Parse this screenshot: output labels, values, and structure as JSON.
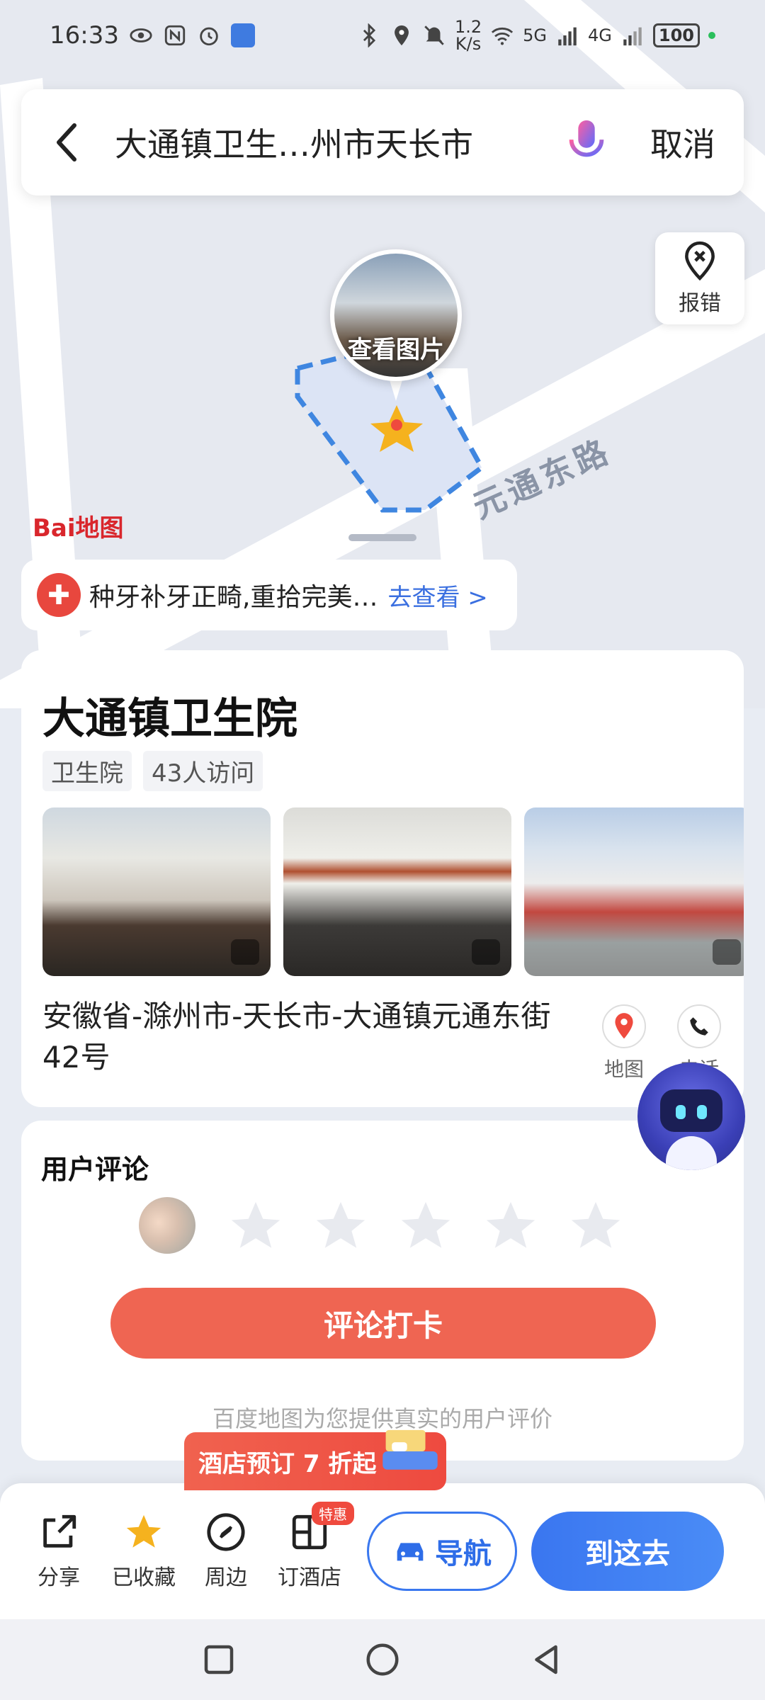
{
  "status": {
    "time": "16:33",
    "speed_top": "1.2",
    "speed_unit": "K/s",
    "battery": "100",
    "signal1": "5G",
    "signal2": "4G"
  },
  "search": {
    "query": "大通镇卫生…州市天长市",
    "cancel": "取消"
  },
  "map": {
    "report_label": "报错",
    "view_photo_label": "查看图片",
    "road_name": "元通东路",
    "logo_text": "Bai地图"
  },
  "ad": {
    "text": "种牙补牙正畸,重拾完美…",
    "link": "去查看 >"
  },
  "place": {
    "name": "大通镇卫生院",
    "tags": [
      "卫生院",
      "43人访问"
    ],
    "address": "安徽省-滁州市-天长市-大通镇元通东街42号",
    "actions": {
      "map": "地图",
      "phone": "电话"
    }
  },
  "review": {
    "title": "用户评论",
    "button": "评论打卡",
    "note": "百度地图为您提供真实的用户评价",
    "stars": 0
  },
  "promo": {
    "text": "酒店预订 7 折起"
  },
  "bottom_bar": {
    "share": "分享",
    "collected": "已收藏",
    "nearby": "周边",
    "hotel": "订酒店",
    "hotel_badge": "特惠",
    "navigate": "导航",
    "go_here": "到这去"
  },
  "colors": {
    "accent": "#3a78ef",
    "review_button": "#ef6552",
    "star_fav": "#f5b21e"
  }
}
